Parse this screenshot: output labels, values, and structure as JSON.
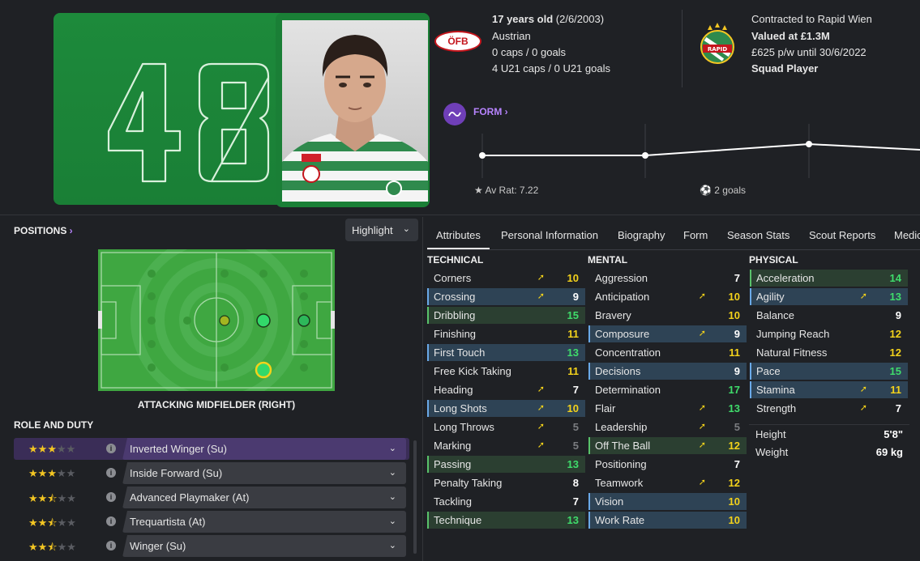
{
  "player": {
    "number": "48",
    "age_line": "17 years old",
    "dob": "(2/6/2003)",
    "nationality": "Austrian",
    "caps": "0 caps / 0 goals",
    "u21_caps": "4 U21 caps / 0 U21 goals",
    "nation_badge": "ÖFB",
    "contract": "Contracted to Rapid Wien",
    "value": "Valued at £1.3M",
    "wage": "£625 p/w until 30/6/2022",
    "squad_status": "Squad Player",
    "club_badge": "RAPID"
  },
  "form": {
    "label": "FORM",
    "av_rating": "Av Rat: 7.22",
    "goals": "2 goals",
    "points": [
      7.1,
      7.1,
      7.2,
      7.15
    ]
  },
  "positions": {
    "title": "POSITIONS",
    "highlight_label": "Highlight",
    "position_label": "ATTACKING MIDFIELDER (RIGHT)"
  },
  "role": {
    "title": "ROLE AND DUTY",
    "rows": [
      {
        "label": "Inverted Winger (Su)",
        "stars": 3,
        "selected": true
      },
      {
        "label": "Inside Forward (Su)",
        "stars": 3,
        "selected": false
      },
      {
        "label": "Advanced Playmaker (At)",
        "stars": 2.5,
        "selected": false
      },
      {
        "label": "Trequartista (At)",
        "stars": 2.5,
        "selected": false
      },
      {
        "label": "Winger (Su)",
        "stars": 2.5,
        "selected": false
      }
    ]
  },
  "tabs": [
    "Attributes",
    "Personal Information",
    "Biography",
    "Form",
    "Season Stats",
    "Scout Reports",
    "Medical"
  ],
  "attributes": {
    "technical_title": "TECHNICAL",
    "mental_title": "MENTAL",
    "physical_title": "PHYSICAL",
    "technical": [
      {
        "name": "Corners",
        "value": "10",
        "arrow": true,
        "hl": "",
        "color": "yellow"
      },
      {
        "name": "Crossing",
        "value": "9",
        "arrow": true,
        "hl": "blue",
        "color": "white"
      },
      {
        "name": "Dribbling",
        "value": "15",
        "arrow": false,
        "hl": "green",
        "color": "green"
      },
      {
        "name": "Finishing",
        "value": "11",
        "arrow": false,
        "hl": "",
        "color": "yellow"
      },
      {
        "name": "First Touch",
        "value": "13",
        "arrow": false,
        "hl": "blue",
        "color": "green"
      },
      {
        "name": "Free Kick Taking",
        "value": "11",
        "arrow": false,
        "hl": "",
        "color": "yellow"
      },
      {
        "name": "Heading",
        "value": "7",
        "arrow": true,
        "hl": "",
        "color": "white"
      },
      {
        "name": "Long Shots",
        "value": "10",
        "arrow": true,
        "hl": "blue",
        "color": "yellow"
      },
      {
        "name": "Long Throws",
        "value": "5",
        "arrow": true,
        "hl": "",
        "color": "grey"
      },
      {
        "name": "Marking",
        "value": "5",
        "arrow": true,
        "hl": "",
        "color": "grey"
      },
      {
        "name": "Passing",
        "value": "13",
        "arrow": false,
        "hl": "green",
        "color": "green"
      },
      {
        "name": "Penalty Taking",
        "value": "8",
        "arrow": false,
        "hl": "",
        "color": "white"
      },
      {
        "name": "Tackling",
        "value": "7",
        "arrow": false,
        "hl": "",
        "color": "white"
      },
      {
        "name": "Technique",
        "value": "13",
        "arrow": false,
        "hl": "green",
        "color": "green"
      }
    ],
    "mental": [
      {
        "name": "Aggression",
        "value": "7",
        "arrow": false,
        "hl": "",
        "color": "white"
      },
      {
        "name": "Anticipation",
        "value": "10",
        "arrow": true,
        "hl": "",
        "color": "yellow"
      },
      {
        "name": "Bravery",
        "value": "10",
        "arrow": false,
        "hl": "",
        "color": "yellow"
      },
      {
        "name": "Composure",
        "value": "9",
        "arrow": true,
        "hl": "blue",
        "color": "white"
      },
      {
        "name": "Concentration",
        "value": "11",
        "arrow": false,
        "hl": "",
        "color": "yellow"
      },
      {
        "name": "Decisions",
        "value": "9",
        "arrow": false,
        "hl": "blue",
        "color": "white"
      },
      {
        "name": "Determination",
        "value": "17",
        "arrow": false,
        "hl": "",
        "color": "green"
      },
      {
        "name": "Flair",
        "value": "13",
        "arrow": true,
        "hl": "",
        "color": "green"
      },
      {
        "name": "Leadership",
        "value": "5",
        "arrow": true,
        "hl": "",
        "color": "grey"
      },
      {
        "name": "Off The Ball",
        "value": "12",
        "arrow": true,
        "hl": "green",
        "color": "yellow"
      },
      {
        "name": "Positioning",
        "value": "7",
        "arrow": false,
        "hl": "",
        "color": "white"
      },
      {
        "name": "Teamwork",
        "value": "12",
        "arrow": true,
        "hl": "",
        "color": "yellow"
      },
      {
        "name": "Vision",
        "value": "10",
        "arrow": false,
        "hl": "blue",
        "color": "yellow"
      },
      {
        "name": "Work Rate",
        "value": "10",
        "arrow": false,
        "hl": "blue",
        "color": "yellow"
      }
    ],
    "physical": [
      {
        "name": "Acceleration",
        "value": "14",
        "arrow": false,
        "hl": "green",
        "color": "green"
      },
      {
        "name": "Agility",
        "value": "13",
        "arrow": true,
        "hl": "blue",
        "color": "green"
      },
      {
        "name": "Balance",
        "value": "9",
        "arrow": false,
        "hl": "",
        "color": "white"
      },
      {
        "name": "Jumping Reach",
        "value": "12",
        "arrow": false,
        "hl": "",
        "color": "yellow"
      },
      {
        "name": "Natural Fitness",
        "value": "12",
        "arrow": false,
        "hl": "",
        "color": "yellow"
      },
      {
        "name": "Pace",
        "value": "15",
        "arrow": false,
        "hl": "blue",
        "color": "green"
      },
      {
        "name": "Stamina",
        "value": "11",
        "arrow": true,
        "hl": "blue",
        "color": "yellow"
      },
      {
        "name": "Strength",
        "value": "7",
        "arrow": true,
        "hl": "",
        "color": "white"
      }
    ],
    "height_label": "Height",
    "height": "5'8\"",
    "weight_label": "Weight",
    "weight": "69 kg"
  },
  "colors": {
    "accent_purple": "#b784ff",
    "pitch_green": "#3fa741",
    "value_green": "#3fdc6b",
    "value_yellow": "#f3d21b"
  }
}
